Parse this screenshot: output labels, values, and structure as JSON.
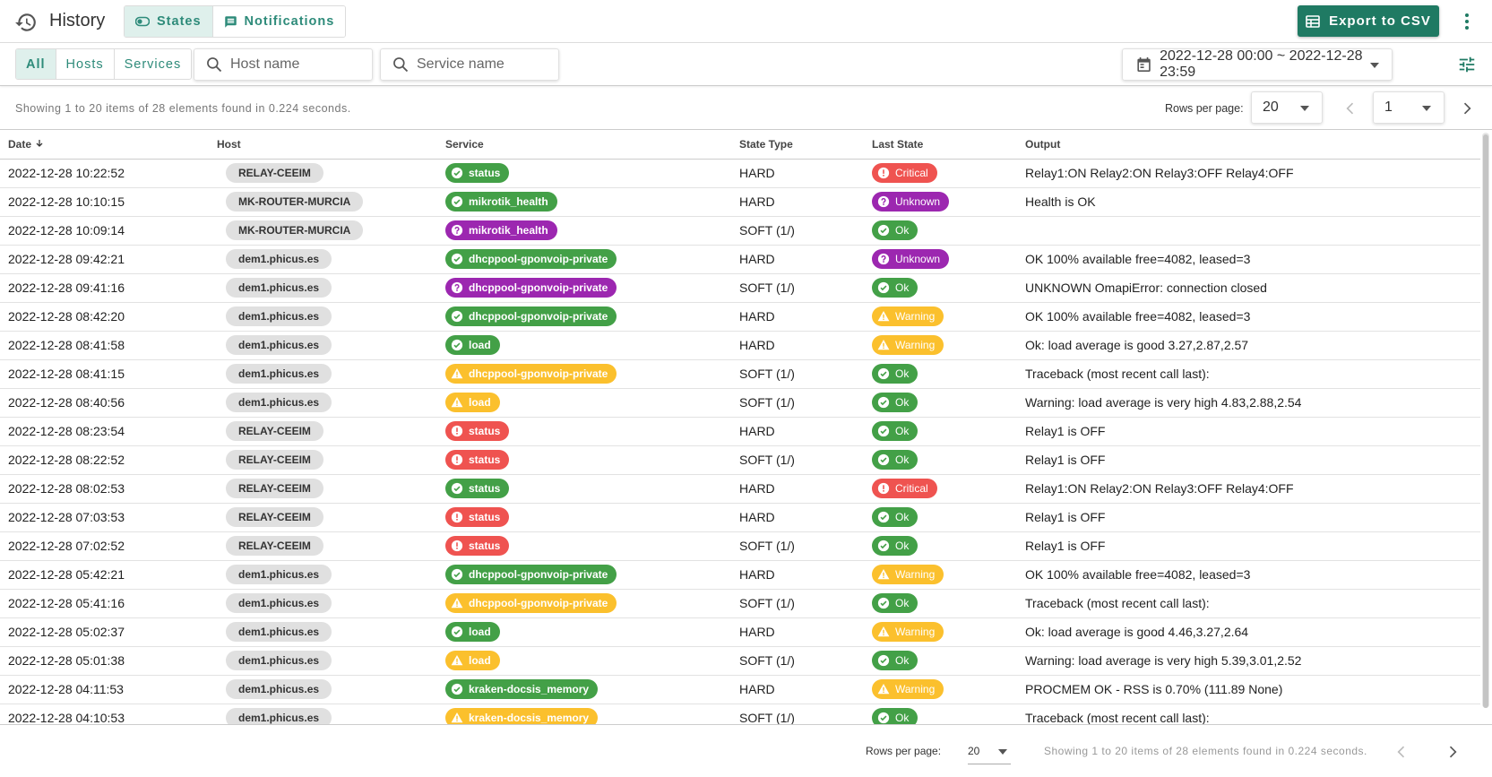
{
  "header": {
    "title": "History",
    "tabs": [
      {
        "label": "States",
        "active": true,
        "icon": "toggle-icon"
      },
      {
        "label": "Notifications",
        "active": false,
        "icon": "message-icon"
      }
    ],
    "export_label": "Export to CSV",
    "accent_color": "#1f7a63"
  },
  "filters": {
    "segments": [
      {
        "label": "All",
        "active": true
      },
      {
        "label": "Hosts",
        "active": false
      },
      {
        "label": "Services",
        "active": false
      }
    ],
    "host_placeholder": "Host name",
    "service_placeholder": "Service name",
    "date_range": "2022-12-28 00:00 ~ 2022-12-28 23:59"
  },
  "pagination": {
    "info": "Showing 1 to 20 items of 28 elements found in 0.224 seconds.",
    "rows_label": "Rows per page:",
    "rows_per_page": "20",
    "page": "1"
  },
  "table": {
    "columns": {
      "date": "Date",
      "host": "Host",
      "service": "Service",
      "state_type": "State Type",
      "last_state": "Last State",
      "output": "Output"
    },
    "rows": [
      {
        "date": "2022-12-28 10:22:52",
        "host": "RELAY-CEEIM",
        "service": "status",
        "service_state": "ok",
        "state_type": "HARD",
        "last_state": "Critical",
        "last_state_kind": "critical",
        "output": "Relay1:ON Relay2:ON Relay3:OFF Relay4:OFF"
      },
      {
        "date": "2022-12-28 10:10:15",
        "host": "MK-ROUTER-MURCIA",
        "service": "mikrotik_health",
        "service_state": "ok",
        "state_type": "HARD",
        "last_state": "Unknown",
        "last_state_kind": "unknown",
        "output": "Health is OK"
      },
      {
        "date": "2022-12-28 10:09:14",
        "host": "MK-ROUTER-MURCIA",
        "service": "mikrotik_health",
        "service_state": "unknown",
        "state_type": "SOFT (1/)",
        "last_state": "Ok",
        "last_state_kind": "ok",
        "output": ""
      },
      {
        "date": "2022-12-28 09:42:21",
        "host": "dem1.phicus.es",
        "service": "dhcppool-gponvoip-private",
        "service_state": "ok",
        "state_type": "HARD",
        "last_state": "Unknown",
        "last_state_kind": "unknown",
        "output": "OK 100% available free=4082, leased=3"
      },
      {
        "date": "2022-12-28 09:41:16",
        "host": "dem1.phicus.es",
        "service": "dhcppool-gponvoip-private",
        "service_state": "unknown",
        "state_type": "SOFT (1/)",
        "last_state": "Ok",
        "last_state_kind": "ok",
        "output": "UNKNOWN OmapiError: connection closed"
      },
      {
        "date": "2022-12-28 08:42:20",
        "host": "dem1.phicus.es",
        "service": "dhcppool-gponvoip-private",
        "service_state": "ok",
        "state_type": "HARD",
        "last_state": "Warning",
        "last_state_kind": "warning",
        "output": "OK 100% available free=4082, leased=3"
      },
      {
        "date": "2022-12-28 08:41:58",
        "host": "dem1.phicus.es",
        "service": "load",
        "service_state": "ok",
        "state_type": "HARD",
        "last_state": "Warning",
        "last_state_kind": "warning",
        "output": "Ok: load average is good 3.27,2.87,2.57"
      },
      {
        "date": "2022-12-28 08:41:15",
        "host": "dem1.phicus.es",
        "service": "dhcppool-gponvoip-private",
        "service_state": "warning",
        "state_type": "SOFT (1/)",
        "last_state": "Ok",
        "last_state_kind": "ok",
        "output": "Traceback (most recent call last):"
      },
      {
        "date": "2022-12-28 08:40:56",
        "host": "dem1.phicus.es",
        "service": "load",
        "service_state": "warning",
        "state_type": "SOFT (1/)",
        "last_state": "Ok",
        "last_state_kind": "ok",
        "output": "Warning: load average is very high 4.83,2.88,2.54"
      },
      {
        "date": "2022-12-28 08:23:54",
        "host": "RELAY-CEEIM",
        "service": "status",
        "service_state": "critical",
        "state_type": "HARD",
        "last_state": "Ok",
        "last_state_kind": "ok",
        "output": "Relay1 is OFF"
      },
      {
        "date": "2022-12-28 08:22:52",
        "host": "RELAY-CEEIM",
        "service": "status",
        "service_state": "critical",
        "state_type": "SOFT (1/)",
        "last_state": "Ok",
        "last_state_kind": "ok",
        "output": "Relay1 is OFF"
      },
      {
        "date": "2022-12-28 08:02:53",
        "host": "RELAY-CEEIM",
        "service": "status",
        "service_state": "ok",
        "state_type": "HARD",
        "last_state": "Critical",
        "last_state_kind": "critical",
        "output": "Relay1:ON Relay2:ON Relay3:OFF Relay4:OFF"
      },
      {
        "date": "2022-12-28 07:03:53",
        "host": "RELAY-CEEIM",
        "service": "status",
        "service_state": "critical",
        "state_type": "HARD",
        "last_state": "Ok",
        "last_state_kind": "ok",
        "output": "Relay1 is OFF"
      },
      {
        "date": "2022-12-28 07:02:52",
        "host": "RELAY-CEEIM",
        "service": "status",
        "service_state": "critical",
        "state_type": "SOFT (1/)",
        "last_state": "Ok",
        "last_state_kind": "ok",
        "output": "Relay1 is OFF"
      },
      {
        "date": "2022-12-28 05:42:21",
        "host": "dem1.phicus.es",
        "service": "dhcppool-gponvoip-private",
        "service_state": "ok",
        "state_type": "HARD",
        "last_state": "Warning",
        "last_state_kind": "warning",
        "output": "OK 100% available free=4082, leased=3"
      },
      {
        "date": "2022-12-28 05:41:16",
        "host": "dem1.phicus.es",
        "service": "dhcppool-gponvoip-private",
        "service_state": "warning",
        "state_type": "SOFT (1/)",
        "last_state": "Ok",
        "last_state_kind": "ok",
        "output": "Traceback (most recent call last):"
      },
      {
        "date": "2022-12-28 05:02:37",
        "host": "dem1.phicus.es",
        "service": "load",
        "service_state": "ok",
        "state_type": "HARD",
        "last_state": "Warning",
        "last_state_kind": "warning",
        "output": "Ok: load average is good 4.46,3.27,2.64"
      },
      {
        "date": "2022-12-28 05:01:38",
        "host": "dem1.phicus.es",
        "service": "load",
        "service_state": "warning",
        "state_type": "SOFT (1/)",
        "last_state": "Ok",
        "last_state_kind": "ok",
        "output": "Warning: load average is very high 5.39,3.01,2.52"
      },
      {
        "date": "2022-12-28 04:11:53",
        "host": "dem1.phicus.es",
        "service": "kraken-docsis_memory",
        "service_state": "ok",
        "state_type": "HARD",
        "last_state": "Warning",
        "last_state_kind": "warning",
        "output": "PROCMEM OK - RSS is 0.70% (111.89 None)"
      },
      {
        "date": "2022-12-28 04:10:53",
        "host": "dem1.phicus.es",
        "service": "kraken-docsis_memory",
        "service_state": "warning",
        "state_type": "SOFT (1/)",
        "last_state": "Ok",
        "last_state_kind": "ok",
        "output": "Traceback (most recent call last):"
      }
    ]
  },
  "footer": {
    "rows_label": "Rows per page:",
    "rows_per_page": "20",
    "info": "Showing 1 to 20 items of 28 elements found in 0.224 seconds."
  },
  "state_colors": {
    "ok": "#43a047",
    "warning": "#fbc02d",
    "critical": "#ef5350",
    "unknown": "#9c27b0"
  }
}
